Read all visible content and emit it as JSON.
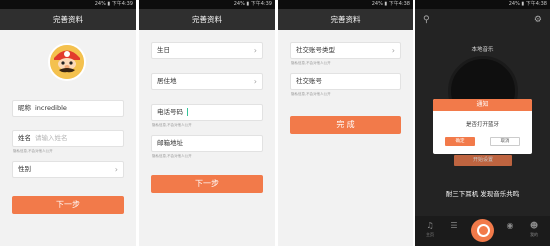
{
  "status_bars": [
    {
      "left": "",
      "right": "24% ▮ 下午4:39"
    },
    {
      "left": "",
      "right": "24% ▮ 下午4:39"
    },
    {
      "left": "",
      "right": "24% ▮ 下午4:38"
    },
    {
      "left": "",
      "right": "24% ▮ 下午4:38"
    }
  ],
  "screen1": {
    "title": "完善资料",
    "nickname_label": "昵称",
    "nickname_value": "incredible",
    "name_label": "姓名",
    "name_placeholder": "请输入姓名",
    "name_hint": "隐私信息,不会对他人公开",
    "gender_label": "性别",
    "next_button": "下一步"
  },
  "screen2": {
    "title": "完善资料",
    "birthday_label": "生日",
    "residence_label": "居住地",
    "phone_label": "电话号码",
    "phone_hint": "隐私信息,不会对他人公开",
    "email_label": "邮箱地址",
    "email_hint": "隐私信息,不会对他人公开",
    "next_button": "下一步"
  },
  "screen3": {
    "title": "完善资料",
    "social_type_label": "社交账号类型",
    "social_type_hint": "隐私信息,不会对他人公开",
    "social_account_label": "社交账号",
    "social_account_hint": "隐私信息,不会对他人公开",
    "complete_button": "完 成"
  },
  "screen4": {
    "local_music_label": "本地音乐",
    "dialog_title": "通知",
    "dialog_message": "是否打开蓝牙",
    "dialog_ok": "确定",
    "dialog_cancel": "取消",
    "behind_button": "开始设置",
    "bottom_text": "耐三下耳机  发现音乐共鸣",
    "nav": [
      "主页",
      "",
      "",
      "我的"
    ]
  },
  "colors": {
    "accent": "#f27a4a",
    "titlebar": "#2f2f2f",
    "background": "#f2f2f2"
  }
}
